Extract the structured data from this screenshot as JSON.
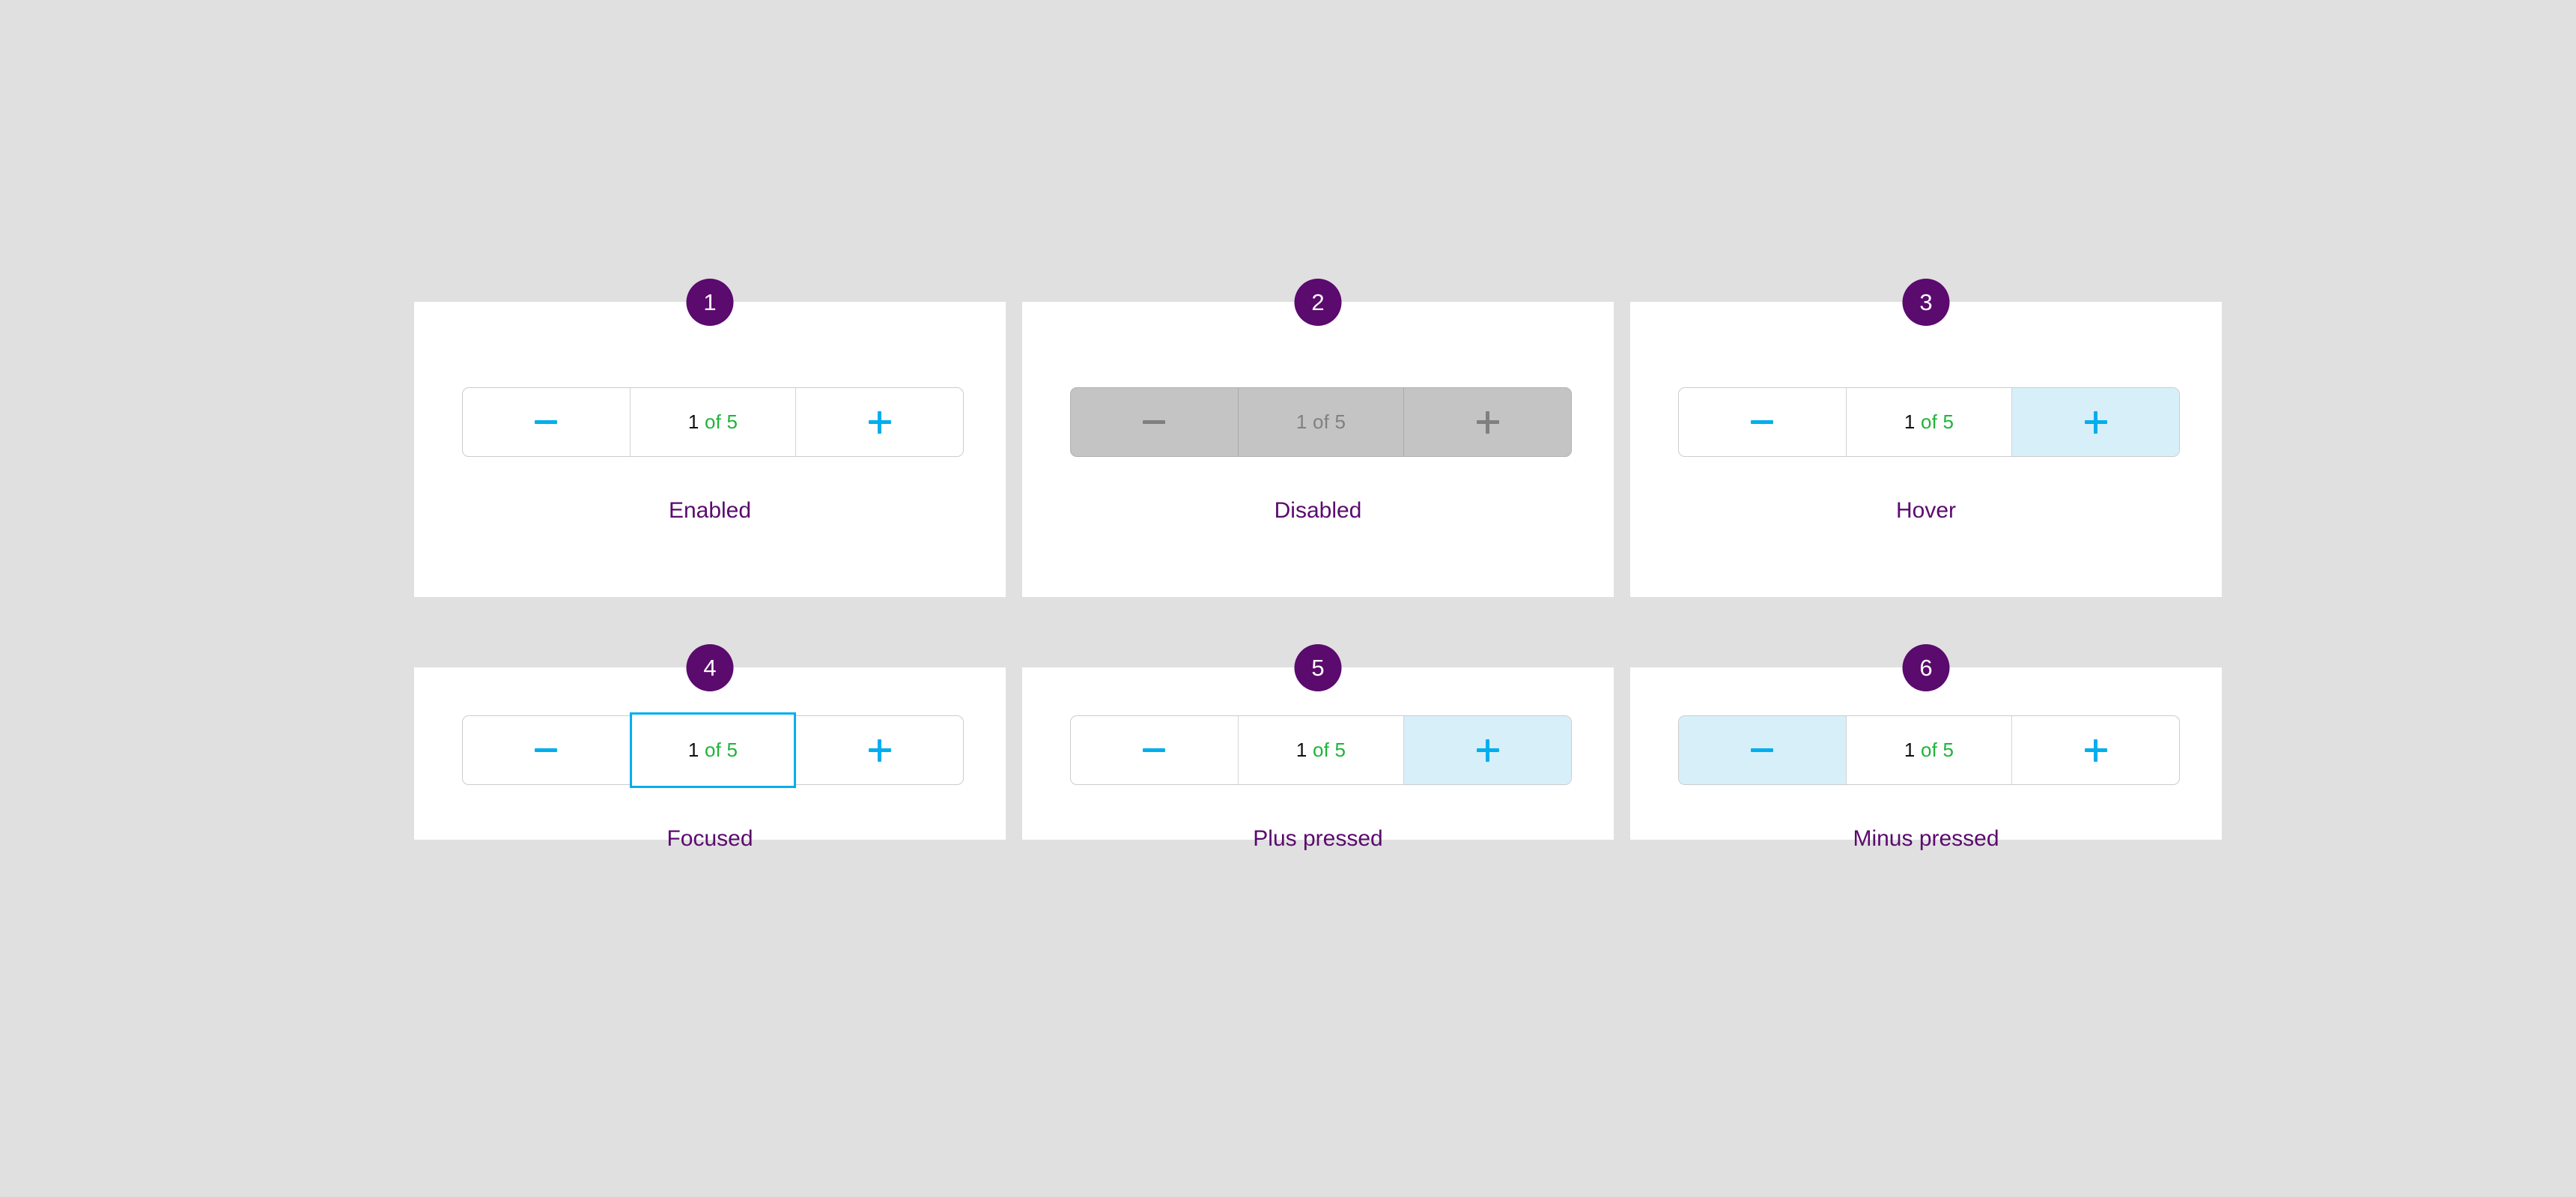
{
  "page": {
    "background_color": "#e0e0e0",
    "card_background": "#ffffff"
  },
  "theme": {
    "badge_purple": "#5b0a6e",
    "caption_purple": "#5b0a6e",
    "accent_blue": "#00aeef",
    "highlight_blue": "#d7eff9",
    "value_green": "#20b33a",
    "value_black": "#111111",
    "border_grey": "#cccccc",
    "divider_grey": "#d4d4d4",
    "disabled_fill": "#c4c4c4",
    "disabled_text": "#808080"
  },
  "stepper": {
    "value": "1",
    "range_label": "of 5",
    "minus_icon": "minus-icon",
    "plus_icon": "plus-icon",
    "min": 1,
    "max": 5
  },
  "cards": [
    {
      "badge": "1",
      "caption": "Enabled",
      "state": "enabled",
      "value": "1",
      "range_label": "of 5"
    },
    {
      "badge": "2",
      "caption": "Disabled",
      "state": "disabled",
      "value": "1",
      "range_label": "of 5"
    },
    {
      "badge": "3",
      "caption": "Hover",
      "state": "hover",
      "value": "1",
      "range_label": "of 5"
    },
    {
      "badge": "4",
      "caption": "Focused",
      "state": "focused",
      "value": "1",
      "range_label": "of 5"
    },
    {
      "badge": "5",
      "caption": "Plus pressed",
      "state": "plus-pressed",
      "value": "1",
      "range_label": "of 5"
    },
    {
      "badge": "6",
      "caption": "Minus pressed",
      "state": "minus-pressed",
      "value": "1",
      "range_label": "of 5"
    }
  ]
}
